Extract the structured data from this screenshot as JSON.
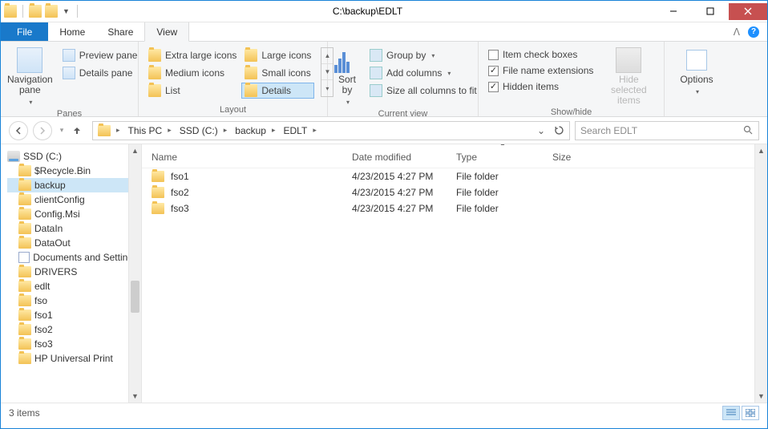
{
  "window": {
    "title": "C:\\backup\\EDLT"
  },
  "menu": {
    "file": "File",
    "home": "Home",
    "share": "Share",
    "view": "View"
  },
  "ribbon": {
    "panes": {
      "label": "Panes",
      "navigation": "Navigation pane",
      "preview": "Preview pane",
      "details": "Details pane"
    },
    "layout": {
      "label": "Layout",
      "extra_large": "Extra large icons",
      "large": "Large icons",
      "medium": "Medium icons",
      "small": "Small icons",
      "list": "List",
      "details": "Details"
    },
    "current_view": {
      "label": "Current view",
      "sort": "Sort by",
      "group": "Group by",
      "add_cols": "Add columns",
      "size_cols": "Size all columns to fit"
    },
    "showhide": {
      "label": "Show/hide",
      "item_check": "Item check boxes",
      "file_ext": "File name extensions",
      "hidden": "Hidden items",
      "hide_selected": "Hide selected items"
    },
    "options": {
      "label": "Options"
    }
  },
  "breadcrumb": {
    "items": [
      "This PC",
      "SSD (C:)",
      "backup",
      "EDLT"
    ]
  },
  "search": {
    "placeholder": "Search EDLT"
  },
  "tree": {
    "root": "SSD (C:)",
    "items": [
      "$Recycle.Bin",
      "backup",
      "clientConfig",
      "Config.Msi",
      "DataIn",
      "DataOut",
      "Documents and Settings",
      "DRIVERS",
      "edlt",
      "fso",
      "fso1",
      "fso2",
      "fso3",
      "HP Universal Print"
    ],
    "selected_index": 1
  },
  "columns": {
    "name": "Name",
    "modified": "Date modified",
    "type": "Type",
    "size": "Size"
  },
  "files": [
    {
      "name": "fso1",
      "modified": "4/23/2015 4:27 PM",
      "type": "File folder"
    },
    {
      "name": "fso2",
      "modified": "4/23/2015 4:27 PM",
      "type": "File folder"
    },
    {
      "name": "fso3",
      "modified": "4/23/2015 4:27 PM",
      "type": "File folder"
    }
  ],
  "status": {
    "count": "3 items"
  },
  "checkboxes": {
    "item_check": false,
    "file_ext": true,
    "hidden": true
  }
}
